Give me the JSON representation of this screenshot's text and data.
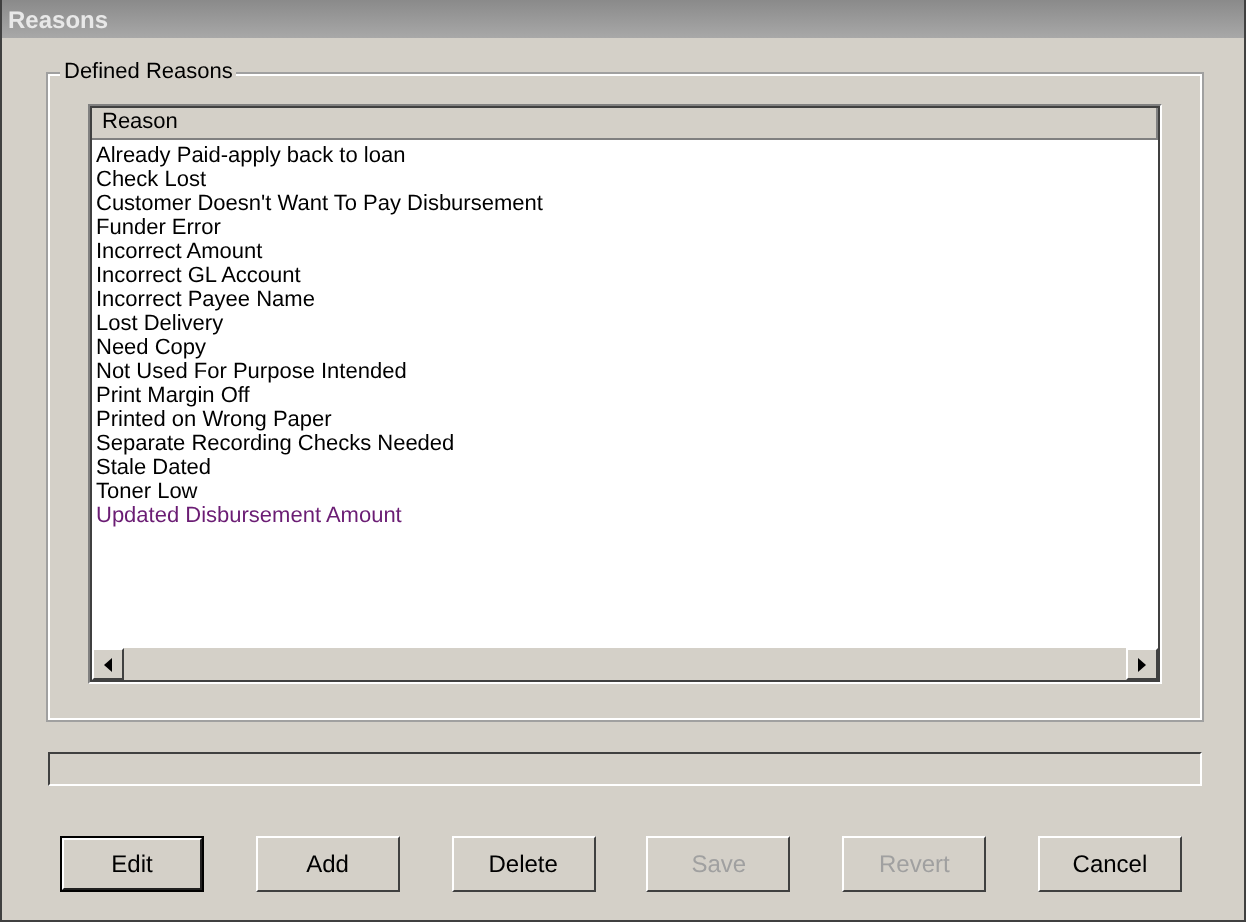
{
  "window": {
    "title": "Reasons"
  },
  "group": {
    "title": "Defined Reasons"
  },
  "list": {
    "columns": [
      "Reason"
    ],
    "rows": [
      {
        "text": "Already Paid-apply back to loan",
        "hovered": false
      },
      {
        "text": "Check Lost",
        "hovered": false
      },
      {
        "text": "Customer Doesn't Want To Pay Disbursement",
        "hovered": false
      },
      {
        "text": "Funder Error",
        "hovered": false
      },
      {
        "text": "Incorrect Amount",
        "hovered": false
      },
      {
        "text": "Incorrect GL Account",
        "hovered": false
      },
      {
        "text": "Incorrect Payee Name",
        "hovered": false
      },
      {
        "text": "Lost Delivery",
        "hovered": false
      },
      {
        "text": "Need Copy",
        "hovered": false
      },
      {
        "text": "Not Used For Purpose Intended",
        "hovered": false
      },
      {
        "text": "Print Margin Off",
        "hovered": false
      },
      {
        "text": "Printed on Wrong Paper",
        "hovered": false
      },
      {
        "text": "Separate Recording Checks Needed",
        "hovered": false
      },
      {
        "text": "Stale Dated",
        "hovered": false
      },
      {
        "text": "Toner Low",
        "hovered": false
      },
      {
        "text": "Updated Disbursement Amount",
        "hovered": true
      }
    ]
  },
  "progress": {
    "level": 0
  },
  "buttons": [
    {
      "label": "Edit",
      "disabled": false,
      "default": true
    },
    {
      "label": "Add",
      "disabled": false,
      "default": false
    },
    {
      "label": "Delete",
      "disabled": false,
      "default": false
    },
    {
      "label": "Save",
      "disabled": true,
      "default": false
    },
    {
      "label": "Revert",
      "disabled": true,
      "default": false
    },
    {
      "label": "Cancel",
      "disabled": false,
      "default": false
    }
  ]
}
